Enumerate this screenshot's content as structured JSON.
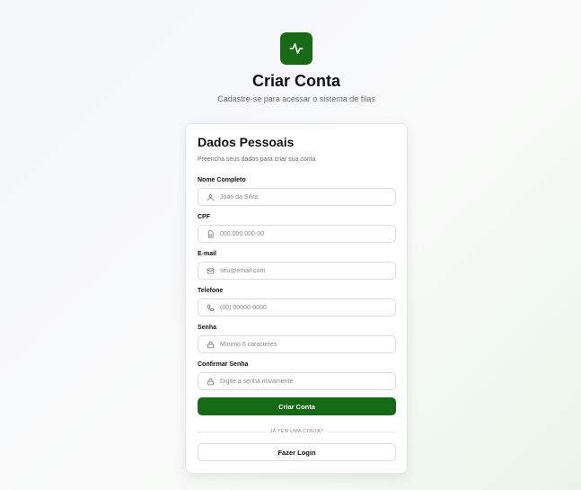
{
  "header": {
    "logo_icon": "activity-icon",
    "title": "Criar Conta",
    "subtitle": "Cadastre-se para acessar o sistema de filas"
  },
  "card": {
    "title": "Dados Pessoais",
    "subtitle": "Preencha seus dados para criar sua conta"
  },
  "fields": {
    "name": {
      "label": "Nome Completo",
      "placeholder": "João da Silva",
      "value": "",
      "icon": "user-icon"
    },
    "cpf": {
      "label": "CPF",
      "placeholder": "000.000.000-00",
      "value": "",
      "icon": "document-icon"
    },
    "email": {
      "label": "E-mail",
      "placeholder": "seu@email.com",
      "value": "",
      "icon": "mail-icon"
    },
    "phone": {
      "label": "Telefone",
      "placeholder": "(00) 00000-0000",
      "value": "",
      "icon": "phone-icon"
    },
    "password": {
      "label": "Senha",
      "placeholder": "Mínimo 6 caracteres",
      "value": "",
      "icon": "lock-icon"
    },
    "confirm_password": {
      "label": "Confirmar Senha",
      "placeholder": "Digite a senha novamente",
      "value": "",
      "icon": "lock-icon"
    }
  },
  "actions": {
    "submit_label": "Criar Conta",
    "divider_text": "JÁ TEM UMA CONTA?",
    "login_label": "Fazer Login"
  },
  "colors": {
    "primary": "#166a16",
    "border": "#dcdcdc",
    "muted_text": "#6b6b6b"
  }
}
